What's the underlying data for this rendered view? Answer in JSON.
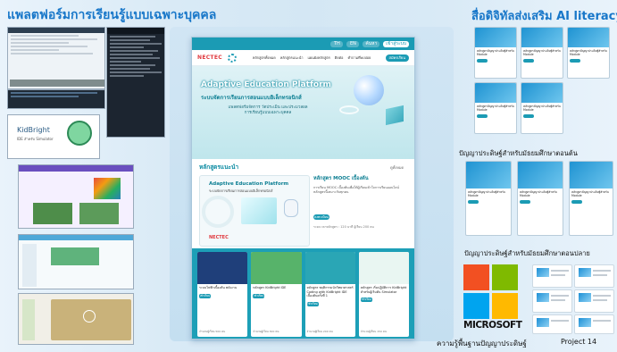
{
  "titles": {
    "left": "แพลตฟอร์มการเรียนรู้แบบเฉพาะบุคคล",
    "right": "สื่อดิจิทัลส่งเสริม AI literacy"
  },
  "left_panel": {
    "kidbright_label": "KidBright",
    "kidbright_sub": "IDE สำหรับ Simulator"
  },
  "site": {
    "topbar": [
      "TH",
      "EN",
      "ค้นหา",
      "เข้าสู่ระบบ"
    ],
    "logo": "NECTEC",
    "menu": [
      "หลักสูตรทั้งหมด",
      "หลักสูตรแนะนำ",
      "แผนผังหลักสูตร",
      "ติดต่อ",
      "คำถามที่พบบ่อย"
    ],
    "cta": "สมัครเรียน",
    "hero_title": "Adaptive Education Platform",
    "hero_sub": "ระบบจัดการเรียนการสอนแบบอิเล็กทรอนิกส์",
    "hero_desc": "แพลตฟอร์มจัดการ วัดประเมิน และประมวลผลการเรียนรู้แบบเฉพาะบุคคล",
    "recommended_heading": "หลักสูตรแนะนำ",
    "see_all": "ดูทั้งหมด",
    "feature": {
      "title": "Adaptive Education Platform",
      "subtitle": "ระบบจัดการเรียนการสอนแบบอิเล็กทรอนิกส์",
      "logo": "NECTEC"
    },
    "feature_text": {
      "title": "หลักสูตร MOOC เบื้องต้น",
      "desc": "การเรียน MOOC เบื้องต้นเพื่อให้ผู้เรียนเข้าใจการเรียนออนไลน์ หลักสูตรนี้เหมาะกับทุกคน",
      "button": "ลงทะเบียน",
      "meta": "ระยะเวลาหลักสูตร : 120 นาที ผู้เรียน 200 คน"
    },
    "courses": [
      {
        "name": "ระบบไฟฟ้าเบื้องต้น พลังงาน",
        "button": "เข้าเรียน",
        "meta": "จำนวนผู้เรียน 500 คน",
        "color": "#1f3f7a"
      },
      {
        "name": "หลักสูตร KidBright IDE",
        "button": "เข้าเรียน",
        "meta": "จำนวนผู้เรียน 300 คน",
        "color": "#57b36a"
      },
      {
        "name": "หลักสูตร พฤติกรรมนักวิทยาศาสตร์ Coding with KidBright IDE เบื้องต้นครั้งที่ 1",
        "button": "เข้าเรียน",
        "meta": "จำนวนผู้เรียน 200 คน",
        "color": "#2aa6b5"
      },
      {
        "name": "หลักสูตร เริ่มปฏิบัติการ KidBright สำหรับผู้เริ่มต้น Simulator",
        "button": "เข้าเรียน",
        "meta": "จำนวนผู้เรียน 150 คน",
        "color": "#e9f6f2"
      }
    ]
  },
  "right_panel": {
    "mini_name": "หลักสูตรปัญญาประดิษฐ์สำหรับ Module",
    "section_mid": "ปัญญาประดิษฐ์สำหรับมัธยมศึกษาตอนต้น",
    "section_low": "ปัญญาประดิษฐ์สำหรับมัธยมศึกษาตอนปลาย",
    "microsoft": "MICROSOFT",
    "footer_left": "ความรู้พื้นฐานปัญญาประดิษฐ์",
    "footer_right": "Project 14"
  },
  "colors": {
    "accent": "#1b9bb4",
    "title_blue": "#1877c9",
    "ms_red": "#f25022",
    "ms_green": "#7fba00",
    "ms_blue": "#00a4ef",
    "ms_yellow": "#ffb900"
  }
}
